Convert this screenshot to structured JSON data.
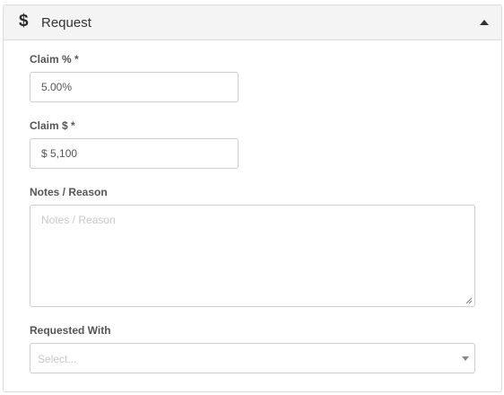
{
  "panel": {
    "title": "Request",
    "icon": "dollar-icon",
    "icon_glyph": "$",
    "collapse_icon": "caret-up-icon"
  },
  "claim_percent": {
    "label": "Claim % *",
    "value": "5.00%"
  },
  "claim_amount": {
    "label": "Claim $ *",
    "value": "$ 5,100"
  },
  "notes": {
    "label": "Notes / Reason",
    "placeholder": "Notes / Reason"
  },
  "requested_with": {
    "label": "Requested With",
    "placeholder": "Select..."
  },
  "colors": {
    "header_bg": "#f4f4f4",
    "border": "#cccccc",
    "label": "#555555",
    "placeholder": "#c7c7c7"
  }
}
